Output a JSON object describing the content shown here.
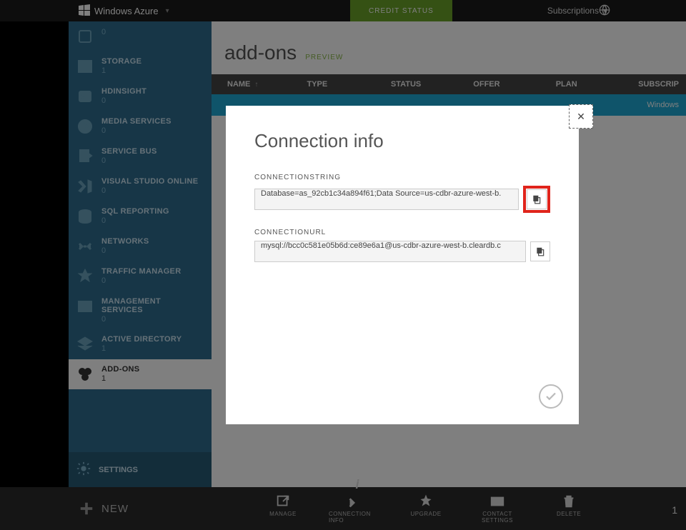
{
  "brand": "Windows Azure",
  "credit_status": "CREDIT STATUS",
  "subscriptions_label": "Subscriptions",
  "page": {
    "title": "add-ons",
    "badge": "PREVIEW"
  },
  "sidebar": {
    "items": [
      {
        "label": "",
        "count": "0"
      },
      {
        "label": "STORAGE",
        "count": "1"
      },
      {
        "label": "HDINSIGHT",
        "count": "0"
      },
      {
        "label": "MEDIA SERVICES",
        "count": "0"
      },
      {
        "label": "SERVICE BUS",
        "count": "0"
      },
      {
        "label": "VISUAL STUDIO ONLINE",
        "count": "0"
      },
      {
        "label": "SQL REPORTING",
        "count": "0"
      },
      {
        "label": "NETWORKS",
        "count": "0"
      },
      {
        "label": "TRAFFIC MANAGER",
        "count": "0"
      },
      {
        "label": "MANAGEMENT SERVICES",
        "count": "0"
      },
      {
        "label": "ACTIVE DIRECTORY",
        "count": "1"
      },
      {
        "label": "ADD-ONS",
        "count": "1"
      }
    ],
    "settings": "SETTINGS"
  },
  "table": {
    "headers": {
      "name": "NAME",
      "type": "TYPE",
      "status": "STATUS",
      "offer": "OFFER",
      "plan": "PLAN",
      "sub": "SUBSCRIP"
    },
    "row": {
      "sub": "Windows"
    }
  },
  "cmdbar": {
    "new": "NEW",
    "items": [
      "MANAGE",
      "CONNECTION INFO",
      "UPGRADE",
      "CONTACT SETTINGS",
      "DELETE"
    ],
    "count": "1"
  },
  "modal": {
    "title": "Connection info",
    "fields": [
      {
        "label": "CONNECTIONSTRING",
        "value": "Database=as_92cb1c34a894f61;Data Source=us-cdbr-azure-west-b."
      },
      {
        "label": "CONNECTIONURL",
        "value": "mysql://bcc0c581e05b6d:ce89e6a1@us-cdbr-azure-west-b.cleardb.c"
      }
    ]
  }
}
